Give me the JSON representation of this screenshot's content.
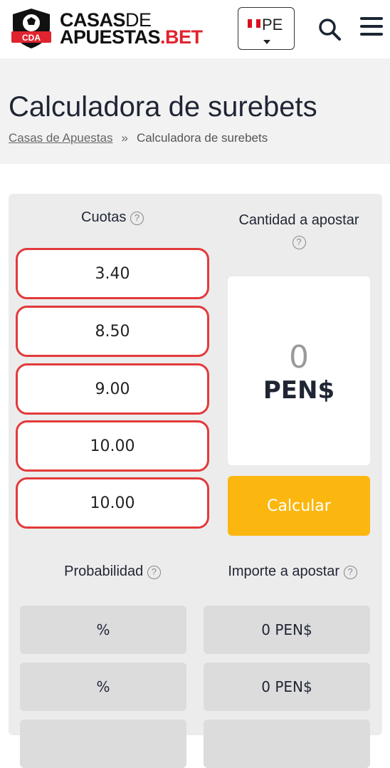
{
  "header": {
    "logo": {
      "badge_text": "CDA",
      "line1_a": "CASAS",
      "line1_b": "DE",
      "line2_a": "APUESTAS",
      "line2_b": ".BET"
    },
    "country": {
      "code": "PE",
      "flag": "peru-flag"
    },
    "icons": {
      "search": "search-icon",
      "menu": "hamburger-menu-icon"
    }
  },
  "page": {
    "title": "Calculadora de surebets",
    "breadcrumb": [
      {
        "label": "Casas de Apuestas"
      },
      {
        "label": "Calculadora de surebets"
      }
    ],
    "breadcrumb_sep": "»"
  },
  "calculator": {
    "odds_header": "Cuotas",
    "stake_header": "Cantidad a apostar",
    "help_symbol": "?",
    "odds": [
      "3.40",
      "8.50",
      "9.00",
      "10.00",
      "10.00"
    ],
    "stake_value": "0",
    "currency": "PEN$",
    "calculate_label": "Calcular",
    "probability_header": "Probabilidad",
    "amount_header": "Importe a apostar",
    "results": [
      {
        "probability": "%",
        "amount": "0 PEN$"
      },
      {
        "probability": "%",
        "amount": "0 PEN$"
      }
    ]
  },
  "colors": {
    "brand_red": "#e0242f",
    "accent_yellow": "#fbb710",
    "input_border": "#e23a3a"
  }
}
